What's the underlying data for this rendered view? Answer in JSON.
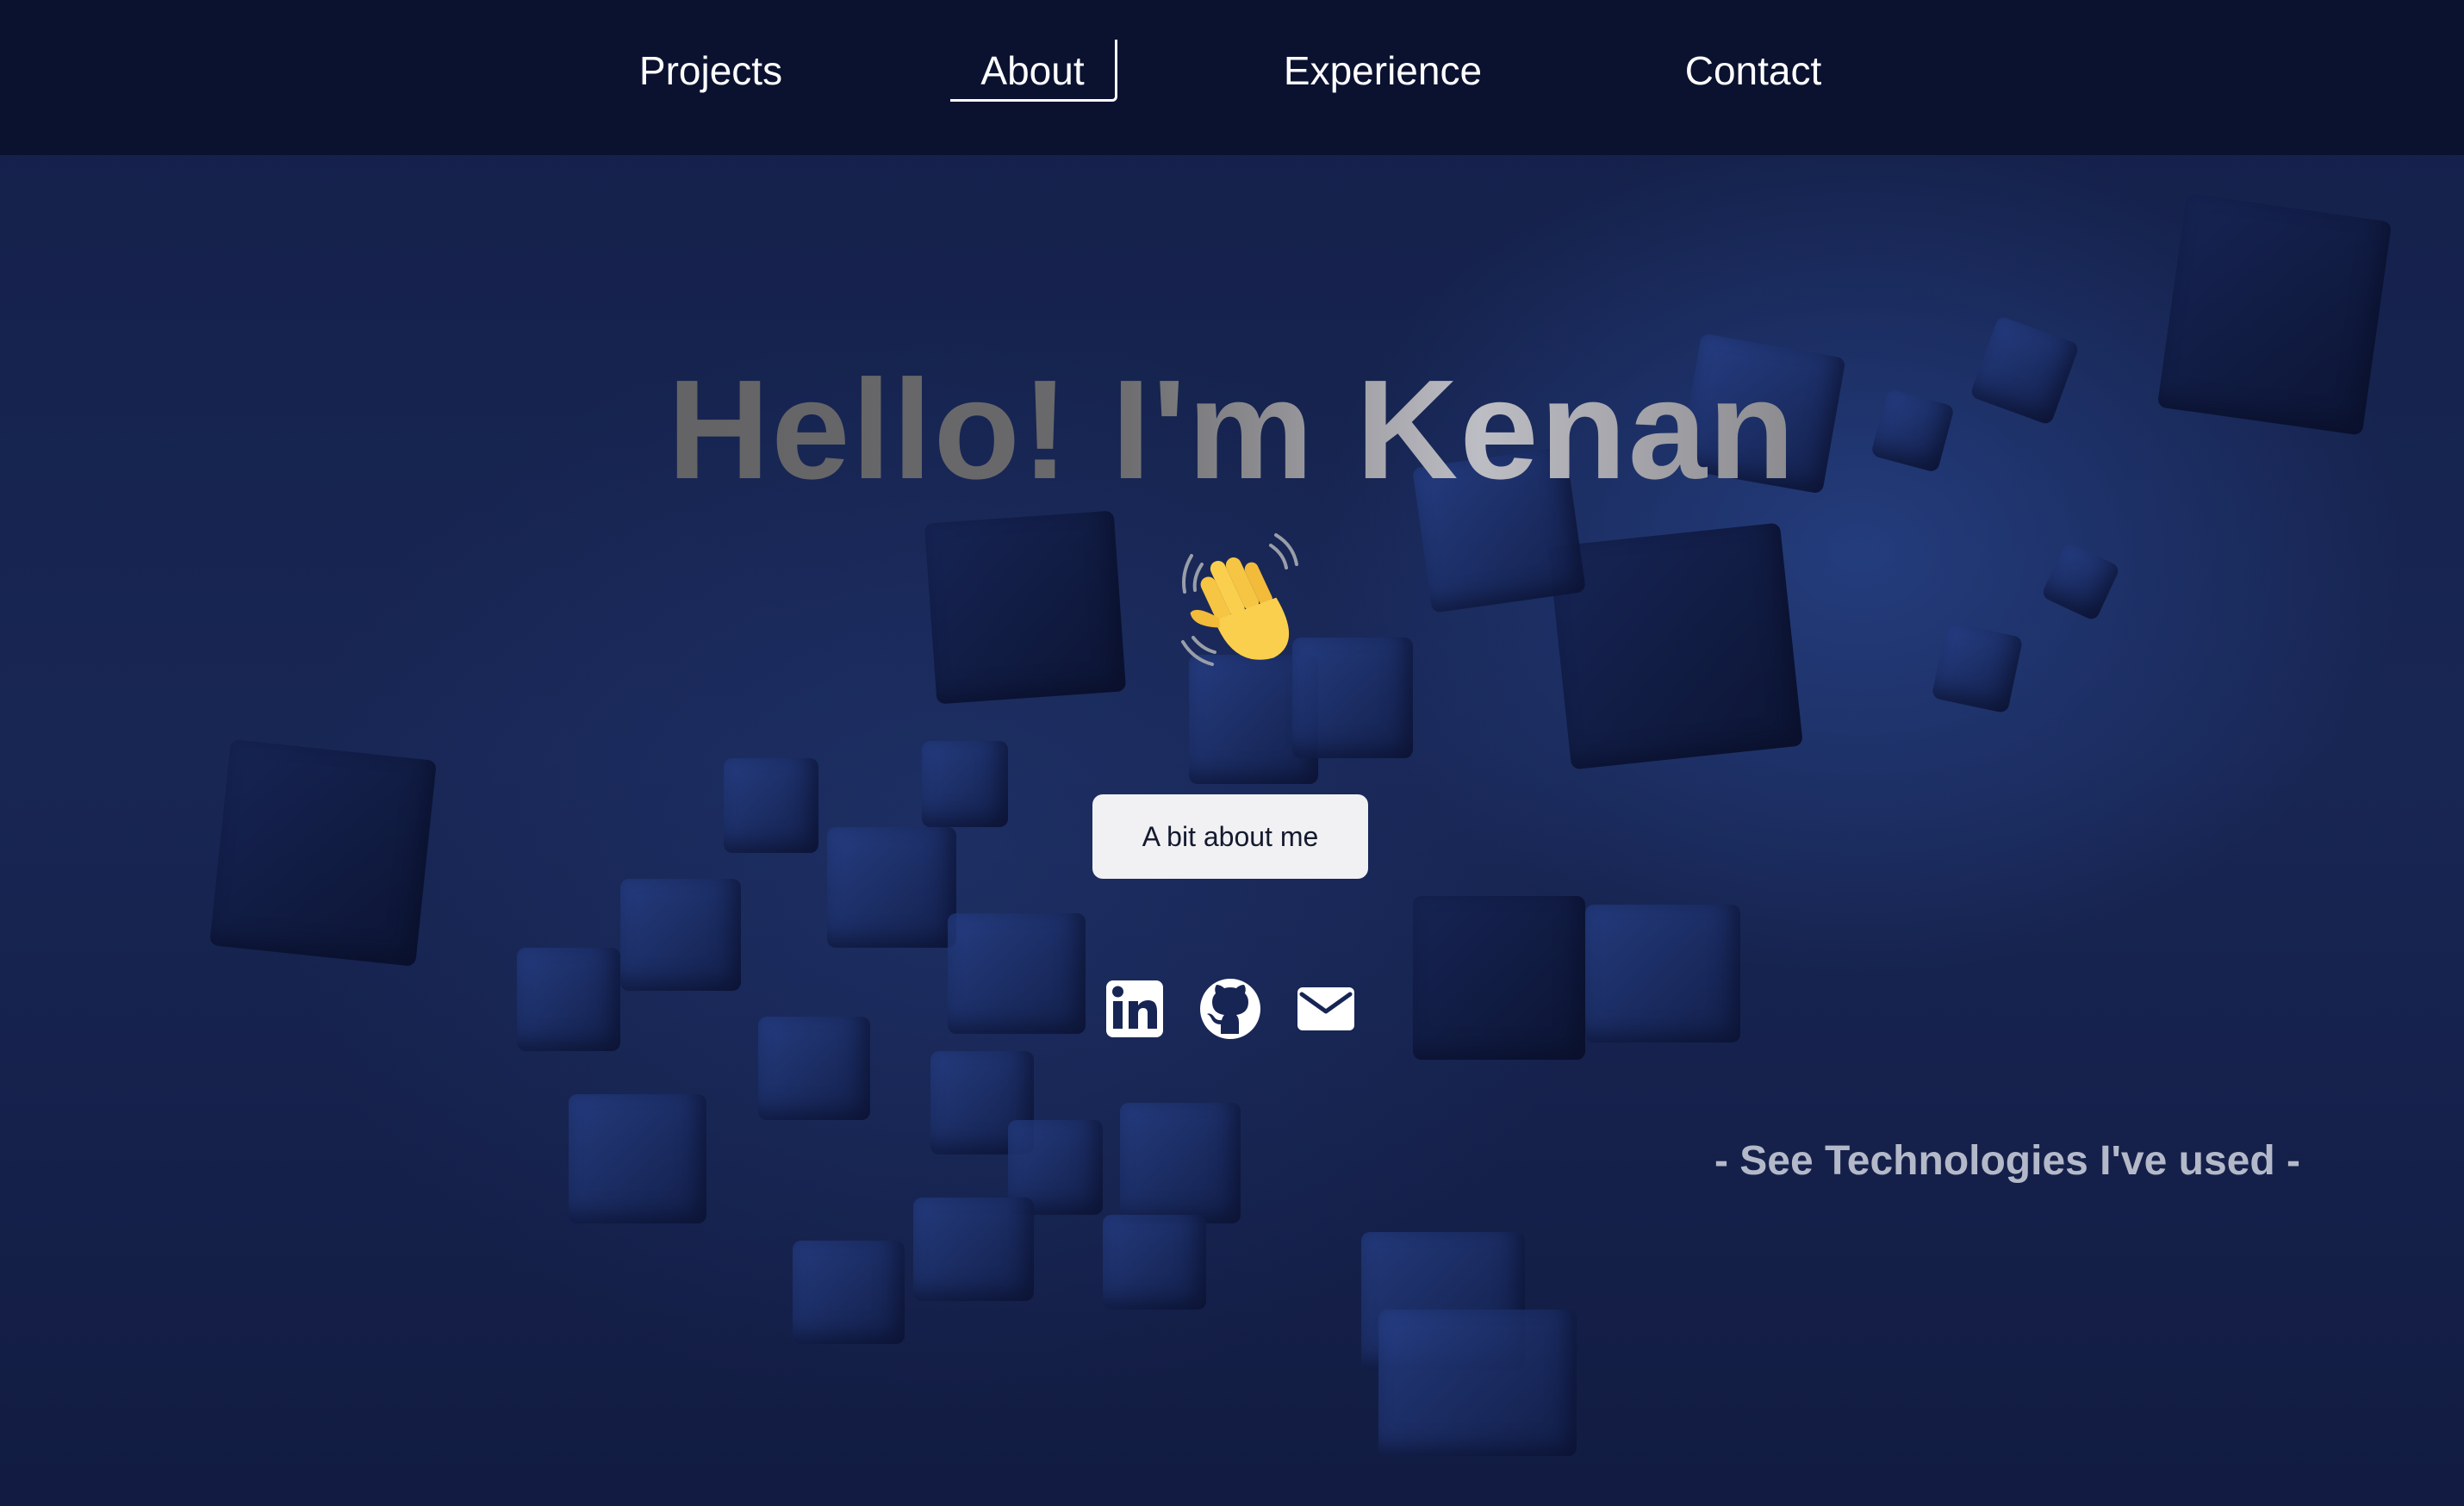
{
  "nav": {
    "items": [
      {
        "label": "Projects"
      },
      {
        "label": "About",
        "active": true
      },
      {
        "label": "Experience"
      },
      {
        "label": "Contact"
      }
    ]
  },
  "hero": {
    "title": "Hello! I'm Kenan",
    "wave_icon": "waving-hand-icon",
    "button_label": "A bit about me",
    "social": [
      {
        "icon": "linkedin-icon"
      },
      {
        "icon": "github-icon"
      },
      {
        "icon": "mail-icon"
      }
    ],
    "tech_link": "- See Technologies I've used -"
  },
  "colors": {
    "nav_bg": "#0b1230",
    "hero_bg": "#172554",
    "button_bg": "#f1f1f3",
    "tech_text": "#b4b9c9"
  }
}
